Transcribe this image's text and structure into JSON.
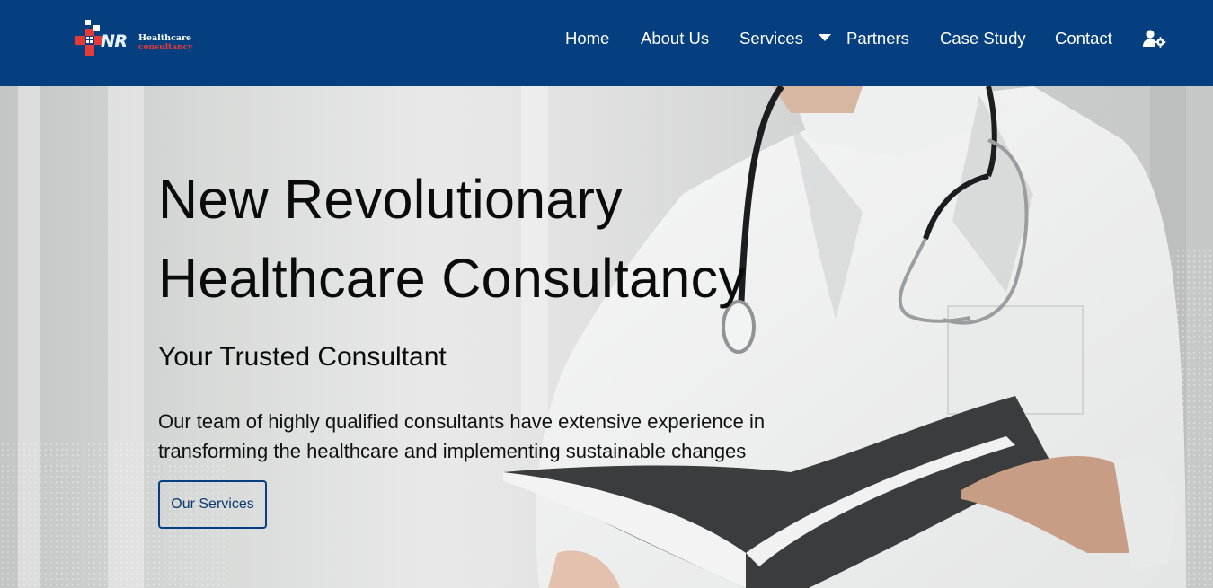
{
  "brand": {
    "logo_mark": "NR",
    "logo_line1": "Healthcare",
    "logo_line2": "consultancy",
    "colors": {
      "header_bg": "#063f7f",
      "accent_red": "#e53a3a"
    }
  },
  "nav": {
    "items": [
      {
        "label": "Home"
      },
      {
        "label": "About Us"
      },
      {
        "label": "Services",
        "has_dropdown": true
      },
      {
        "label": "Partners"
      },
      {
        "label": "Case Study"
      },
      {
        "label": "Contact"
      }
    ],
    "account_icon": "user-gear-icon"
  },
  "hero": {
    "title_line1": "New Revolutionary",
    "title_line2": "Healthcare Consultancy",
    "subtitle": "Your Trusted Consultant",
    "description_line1": "Our team of highly qualified consultants have extensive experience in",
    "description_line2": "transforming the healthcare and implementing sustainable changes",
    "cta_label": "Our Services"
  }
}
